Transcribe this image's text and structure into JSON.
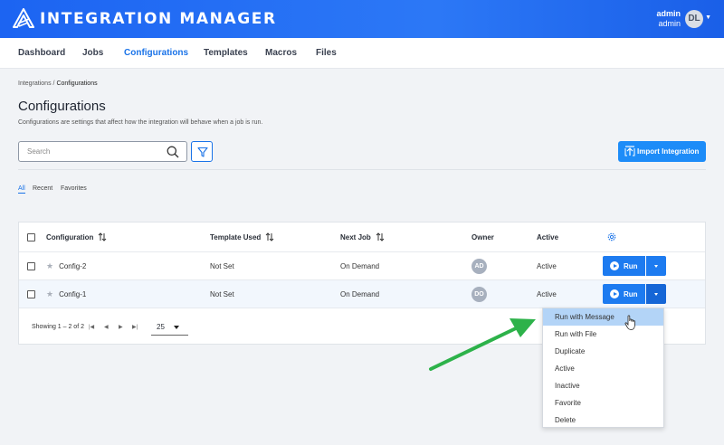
{
  "header": {
    "app_title": "INTEGRATION MANAGER",
    "user_name": "admin",
    "user_role": "admin",
    "avatar_initials": "DL"
  },
  "nav": {
    "items": [
      {
        "label": "Dashboard",
        "active": false
      },
      {
        "label": "Jobs",
        "active": false
      },
      {
        "label": "Configurations",
        "active": true
      },
      {
        "label": "Templates",
        "active": false
      },
      {
        "label": "Macros",
        "active": false
      },
      {
        "label": "Files",
        "active": false
      }
    ]
  },
  "breadcrumb": {
    "parent": "Integrations",
    "separator": "/",
    "current": "Configurations"
  },
  "page": {
    "title": "Configurations",
    "description": "Configurations are settings that affect how the integration will behave when a job is run."
  },
  "search": {
    "placeholder": "Search"
  },
  "import_button": {
    "label": "Import Integration"
  },
  "tabs": [
    "All",
    "Recent",
    "Favorites"
  ],
  "table": {
    "columns": [
      "Configuration",
      "Template Used",
      "Next Job",
      "Owner",
      "Active"
    ],
    "rows": [
      {
        "name": "Config-2",
        "template": "Not Set",
        "next_job": "On Demand",
        "owner": "AD",
        "active": "Active",
        "run_label": "Run"
      },
      {
        "name": "Config-1",
        "template": "Not Set",
        "next_job": "On Demand",
        "owner": "DO",
        "active": "Active",
        "run_label": "Run"
      }
    ]
  },
  "pagination": {
    "showing": "Showing 1 – 2 of 2",
    "page_size": "25"
  },
  "run_menu": {
    "items": [
      "Run with Message",
      "Run with File",
      "Duplicate",
      "Active",
      "Inactive",
      "Favorite",
      "Delete"
    ],
    "highlighted": "Run with Message"
  },
  "colors": {
    "header_blue": "#1c64f2",
    "accent": "#1a73e8",
    "button_blue": "#1d7bf0",
    "menu_highlight": "#b3d4f7",
    "annotation_arrow": "#2db24a"
  }
}
